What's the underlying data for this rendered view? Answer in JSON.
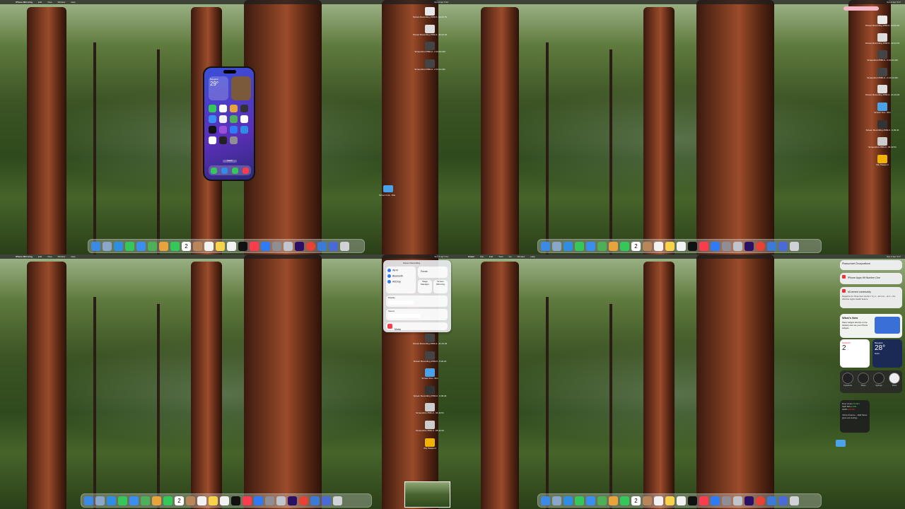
{
  "menubar": [
    {
      "app": "iPhone Mirroring",
      "items": [
        "Edit",
        "View",
        "Window",
        "Help"
      ],
      "clock": "Sun 2 Apr 3:12"
    },
    {
      "app": "",
      "items": [
        "",
        "",
        "",
        ""
      ],
      "clock": "Sun 2 Apr 3:17"
    },
    {
      "app": "iPhone Mirroring",
      "items": [
        "Edit",
        "View",
        "Window",
        "Help"
      ],
      "clock": "Sun 2 Apr 3:11"
    },
    {
      "app": "Finder",
      "items": [
        "File",
        "Edit",
        "View",
        "Go",
        "Window",
        "Help"
      ],
      "clock": "Sun 2 Apr 3:17"
    }
  ],
  "desktop_icons": [
    {
      "label": "Screen Recording 2566-0...04.42.51",
      "color": "#e8e8e8"
    },
    {
      "label": "Screen Recording 2566-0...42.44.44",
      "color": "#dddddd"
    },
    {
      "label": "Screenshot 2566-0...2.13.10.AM",
      "color": "#444444"
    },
    {
      "label": "Screenshot 2566-0...2.13.12.AM",
      "color": "#444444"
    },
    {
      "label": "Screen Recording 2566-0...21.23.33",
      "color": "#dddddd"
    },
    {
      "label": "Screen Recording 2566-0...5.22.24",
      "color": "#dddddd"
    },
    {
      "label": "Screen Recording 2566-0...9.39.40",
      "color": "#333333"
    },
    {
      "label": "Screenshot 2566-0...04.42.51",
      "color": "#cccccc"
    },
    {
      "label": "Screenshot 2566-0...05.42.33",
      "color": "#cccccc"
    },
    {
      "label": "iMy Passport",
      "color": "#f0b400"
    }
  ],
  "desktop_folder": {
    "label": "Screen Ima...Sho"
  },
  "iphone": {
    "time": "20:26",
    "weather_city": "Bangkok",
    "weather_temp": "29°",
    "home_indicator": "Search"
  },
  "control_center": {
    "wifi_label": "Wi-Fi",
    "wifi_value": "iPhone Hotspot_x5",
    "bluetooth_label": "Bluetooth",
    "bluetooth_value": "On",
    "airdrop_label": "AirDrop",
    "airdrop_value": "Contacts Only",
    "focus_label": "Focus",
    "stage_label": "Stage Manager",
    "mirror_label": "Screen Mirroring",
    "display_label": "Display",
    "sound_label": "Sound",
    "music_label": "Music",
    "header": "Screen Recording"
  },
  "notification_center": {
    "notif1": "Phanuchart Chunprathum",
    "notif2": "iPhone Apps Hit Number One",
    "notif3": "#Connect community",
    "notif3_body": "Magazine for those here found it. Try it – let it do – do it – the effective Apple Health feature.",
    "whats_new_title": "What's New",
    "whats_new_body": "Place widgets directly on the desktop and use your iPhone widgets.",
    "calendar_day": "2",
    "calendar_month": "SUNDAY",
    "weather_city": "Bangkok",
    "weather_temp": "28°",
    "weather_desc": "Haze",
    "clocks": [
      "Cupertino",
      "Tokyo",
      "Sydney",
      "Paris"
    ],
    "stocks": [
      {
        "name": "Dow Jones",
        "value": "43,901"
      },
      {
        "name": "S&P 500",
        "value": "6,009"
      },
      {
        "name": "AAPL",
        "value": "247.84"
      }
    ],
    "news": "Yahoo Finance – Wall Street gives are looking..."
  },
  "dock_apps": [
    {
      "name": "finder",
      "color": "#3b8be6"
    },
    {
      "name": "launchpad",
      "color": "#8aa6c8"
    },
    {
      "name": "safari",
      "color": "#2f8de4"
    },
    {
      "name": "messages",
      "color": "#35c759"
    },
    {
      "name": "mail",
      "color": "#3a8ef0"
    },
    {
      "name": "maps",
      "color": "#4fae58"
    },
    {
      "name": "photos",
      "color": "#e8a33c"
    },
    {
      "name": "facetime",
      "color": "#34c759"
    },
    {
      "name": "calendar",
      "color": "#ffffff"
    },
    {
      "name": "contacts",
      "color": "#b8865a"
    },
    {
      "name": "reminders",
      "color": "#f2f2f2"
    },
    {
      "name": "notes",
      "color": "#f7d34a"
    },
    {
      "name": "freeform",
      "color": "#f2f2f2"
    },
    {
      "name": "tv",
      "color": "#111111"
    },
    {
      "name": "music",
      "color": "#fa3c4c"
    },
    {
      "name": "app-store",
      "color": "#2d7cf6"
    },
    {
      "name": "system-settings",
      "color": "#8e8e93"
    },
    {
      "name": "iphone-mirroring",
      "color": "#c0c4cc"
    },
    {
      "name": "premiere",
      "color": "#2a1166"
    },
    {
      "name": "chrome",
      "color": "#e94235"
    },
    {
      "name": "screen-sharing",
      "color": "#3a7bd5"
    },
    {
      "name": "archive",
      "color": "#4a6ad8"
    },
    {
      "name": "trash",
      "color": "#cfd3d8"
    }
  ],
  "dock_calendar_day": "2"
}
